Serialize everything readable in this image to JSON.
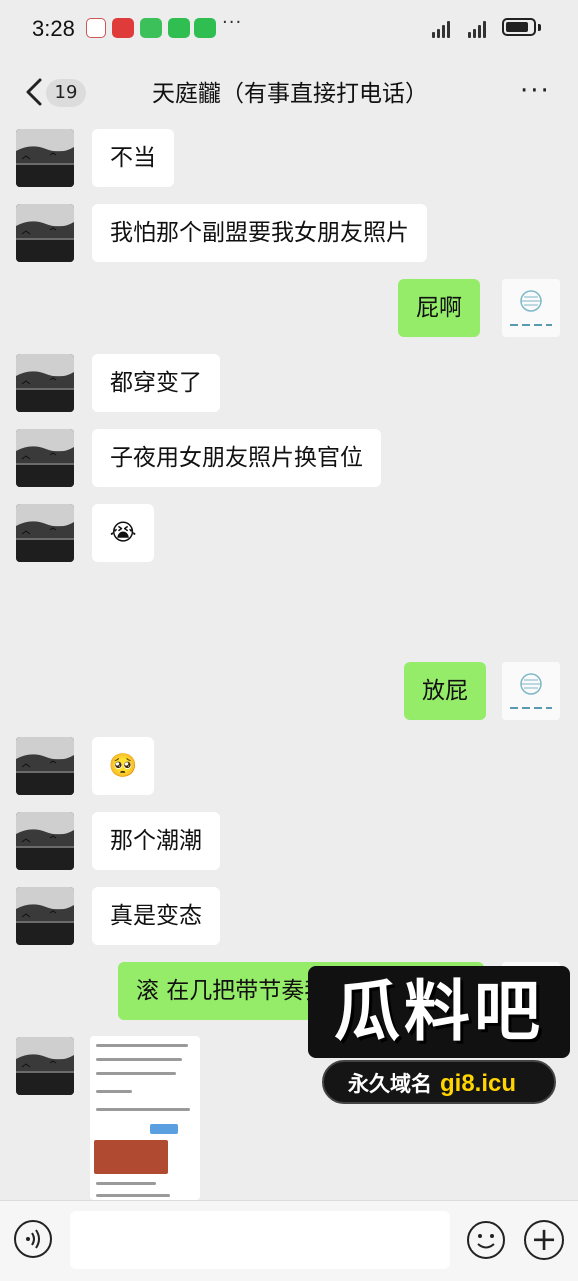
{
  "status_bar": {
    "time": "3:28",
    "app_icons": [
      "dog-app-icon",
      "red-app-icon",
      "green-app-icon",
      "wechat-icon",
      "wechat-icon"
    ],
    "more_indicator": "···"
  },
  "header": {
    "unread_count": "19",
    "title": "天庭龖（有事直接打电话）",
    "more": "···"
  },
  "messages": [
    {
      "side": "left",
      "type": "text",
      "text": "不当"
    },
    {
      "side": "left",
      "type": "text",
      "text": "我怕那个副盟要我女朋友照片"
    },
    {
      "side": "right",
      "type": "text",
      "text": "屁啊"
    },
    {
      "side": "left",
      "type": "text",
      "text": "都穿变了"
    },
    {
      "side": "left",
      "type": "text",
      "text": "子夜用女朋友照片换官位"
    },
    {
      "side": "left",
      "type": "emoji",
      "emoji": "😭"
    },
    {
      "side": "right",
      "type": "text",
      "text": "放屁"
    },
    {
      "side": "left",
      "type": "emoji",
      "emoji": "🥺"
    },
    {
      "side": "left",
      "type": "text",
      "text": "那个潮潮"
    },
    {
      "side": "left",
      "type": "text",
      "text": "真是变态"
    },
    {
      "side": "right",
      "type": "text",
      "text": "滚 在几把带节奏我就"
    },
    {
      "side": "left",
      "type": "image",
      "name": "chat-screenshot-image"
    }
  ],
  "watermark": {
    "logo_text": "瓜料吧",
    "tag_label": "永久域名",
    "domain": "gi8.icu"
  },
  "input_bar": {
    "value": ""
  },
  "colors": {
    "background": "#ededed",
    "incoming_bubble": "#ffffff",
    "outgoing_bubble": "#95ec69"
  }
}
